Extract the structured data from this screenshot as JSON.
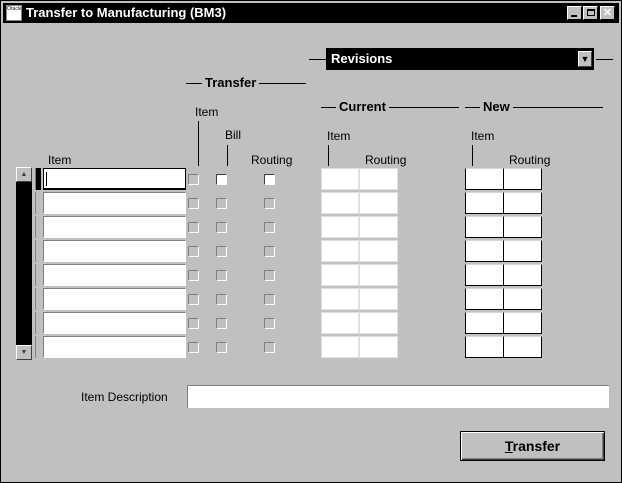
{
  "window": {
    "title": "Transfer to Manufacturing (BM3)",
    "app_icon_text": "Oracle",
    "close_glyph": "✕"
  },
  "revisions_select": {
    "value": "Revisions",
    "arrow": "▼"
  },
  "groups": {
    "transfer": "Transfer",
    "current": "Current",
    "new": "New"
  },
  "columns": {
    "item": "Item",
    "transfer_item": "Item",
    "transfer_bill": "Bill",
    "transfer_routing": "Routing",
    "current_item": "Item",
    "current_routing": "Routing",
    "new_item": "Item",
    "new_routing": "Routing"
  },
  "rows": [
    {
      "item": "",
      "transfer_item": false,
      "transfer_bill": true,
      "transfer_routing": true,
      "current_item": "",
      "current_routing": "",
      "new_item": "",
      "new_routing": ""
    },
    {
      "item": "",
      "transfer_item": false,
      "transfer_bill": false,
      "transfer_routing": false,
      "current_item": "",
      "current_routing": "",
      "new_item": "",
      "new_routing": ""
    },
    {
      "item": "",
      "transfer_item": false,
      "transfer_bill": false,
      "transfer_routing": false,
      "current_item": "",
      "current_routing": "",
      "new_item": "",
      "new_routing": ""
    },
    {
      "item": "",
      "transfer_item": false,
      "transfer_bill": false,
      "transfer_routing": false,
      "current_item": "",
      "current_routing": "",
      "new_item": "",
      "new_routing": ""
    },
    {
      "item": "",
      "transfer_item": false,
      "transfer_bill": false,
      "transfer_routing": false,
      "current_item": "",
      "current_routing": "",
      "new_item": "",
      "new_routing": ""
    },
    {
      "item": "",
      "transfer_item": false,
      "transfer_bill": false,
      "transfer_routing": false,
      "current_item": "",
      "current_routing": "",
      "new_item": "",
      "new_routing": ""
    },
    {
      "item": "",
      "transfer_item": false,
      "transfer_bill": false,
      "transfer_routing": false,
      "current_item": "",
      "current_routing": "",
      "new_item": "",
      "new_routing": ""
    },
    {
      "item": "",
      "transfer_item": false,
      "transfer_bill": false,
      "transfer_routing": false,
      "current_item": "",
      "current_routing": "",
      "new_item": "",
      "new_routing": ""
    }
  ],
  "scrollbar": {
    "up": "▲",
    "down": "▼"
  },
  "item_description": {
    "label": "Item Description",
    "value": ""
  },
  "transfer_button": {
    "mnemonic": "T",
    "rest": "ransfer"
  }
}
